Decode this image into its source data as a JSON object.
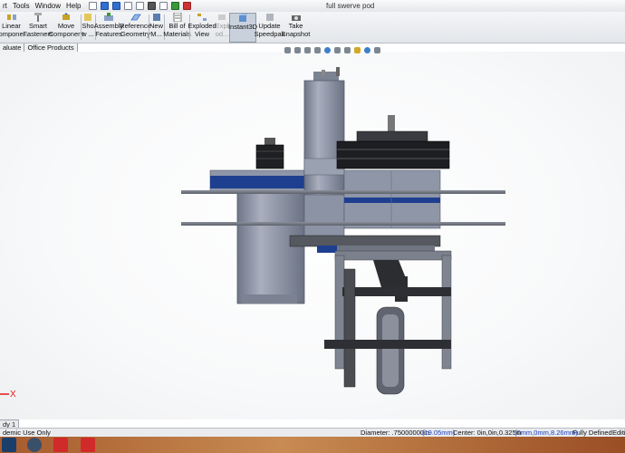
{
  "window": {
    "title": "full swerve pod"
  },
  "menubar": {
    "items": [
      "rt",
      "Tools",
      "Window",
      "Help"
    ]
  },
  "ribbon": {
    "tools": [
      {
        "label": "Linear\nCompone...",
        "icon": "linear-pattern-icon"
      },
      {
        "label": "Smart\nFasteners",
        "icon": "smart-fasteners-icon"
      },
      {
        "label": "Move\nComponent",
        "icon": "move-component-icon"
      },
      {
        "label": "Sho\nw ...",
        "icon": "show-hidden-icon"
      },
      {
        "label": "Assembly\nFeatures",
        "icon": "assembly-features-icon"
      },
      {
        "label": "Reference\nGeometry",
        "icon": "reference-geometry-icon"
      },
      {
        "label": "New\nM...",
        "icon": "new-motion-study-icon"
      },
      {
        "label": "Bill of\nMaterials",
        "icon": "bill-of-materials-icon"
      },
      {
        "label": "Exploded\nView",
        "icon": "exploded-view-icon"
      },
      {
        "label": "Expl\nod...",
        "icon": "explode-line-sketch-icon"
      },
      {
        "label": "Instant3D",
        "icon": "instant3d-icon"
      },
      {
        "label": "Update\nSpeedpak",
        "icon": "update-speedpak-icon"
      },
      {
        "label": "Take\nSnapshot",
        "icon": "take-snapshot-icon"
      }
    ],
    "active_tool": "Instant3D"
  },
  "tabs": [
    {
      "label": "aluate"
    },
    {
      "label": "Office Products"
    }
  ],
  "sheet_tab": {
    "label": "dy 1"
  },
  "triad": {
    "axis_label": "X",
    "axis_color": "#e01b1b"
  },
  "statusbar": {
    "left": "demic Use Only",
    "diameter_label": "Diameter: .75000000in",
    "diameter_mm": "(19.05mm)",
    "center_label": "Center: 0in,0in,0.325in",
    "center_mm": "(0mm,0mm,8.26mm)",
    "state": "Fully Defined",
    "mode": "Editi"
  },
  "taskbar": {
    "apps": [
      "steam-icon",
      "disc-icon",
      "solidworks-icon",
      "solidworks-icon"
    ]
  },
  "colors": {
    "accent_blue": "#1a3fc4",
    "part_gray": "#8e96a8",
    "part_blue": "#1e3f8f"
  }
}
